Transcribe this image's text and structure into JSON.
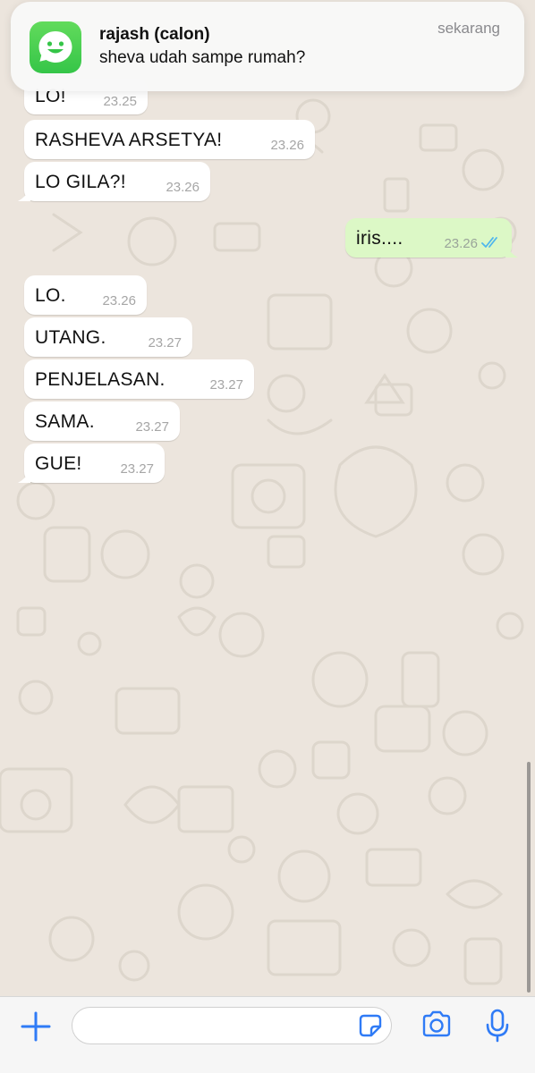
{
  "notification": {
    "app_icon": "whatsapp-icon",
    "title": "rajash (calon)",
    "body": "sheva udah sampe rumah?",
    "time": "sekarang"
  },
  "messages": [
    {
      "dir": "in",
      "text": "LO!",
      "time": "23.25"
    },
    {
      "dir": "in",
      "text": "RASHEVA ARSETYA!",
      "time": "23.26"
    },
    {
      "dir": "in",
      "text": "LO GILA?!",
      "time": "23.26"
    },
    {
      "dir": "out",
      "text": "iris....",
      "time": "23.26",
      "status_icon": "double-check-read-icon"
    },
    {
      "dir": "in",
      "text": "LO.",
      "time": "23.26"
    },
    {
      "dir": "in",
      "text": "UTANG.",
      "time": "23.27"
    },
    {
      "dir": "in",
      "text": "PENJELASAN.",
      "time": "23.27"
    },
    {
      "dir": "in",
      "text": "SAMA.",
      "time": "23.27"
    },
    {
      "dir": "in",
      "text": "GUE!",
      "time": "23.27"
    }
  ],
  "input_bar": {
    "plus_icon": "plus-icon",
    "message_value": "",
    "message_placeholder": "",
    "sticker_icon": "sticker-icon",
    "camera_icon": "camera-icon",
    "mic_icon": "microphone-icon"
  },
  "colors": {
    "wallpaper": "#ece5dd",
    "incoming_bubble": "#ffffff",
    "outgoing_bubble": "#dcf8c6",
    "accent_blue": "#2f7bf6",
    "read_ticks": "#4fb6ec"
  }
}
